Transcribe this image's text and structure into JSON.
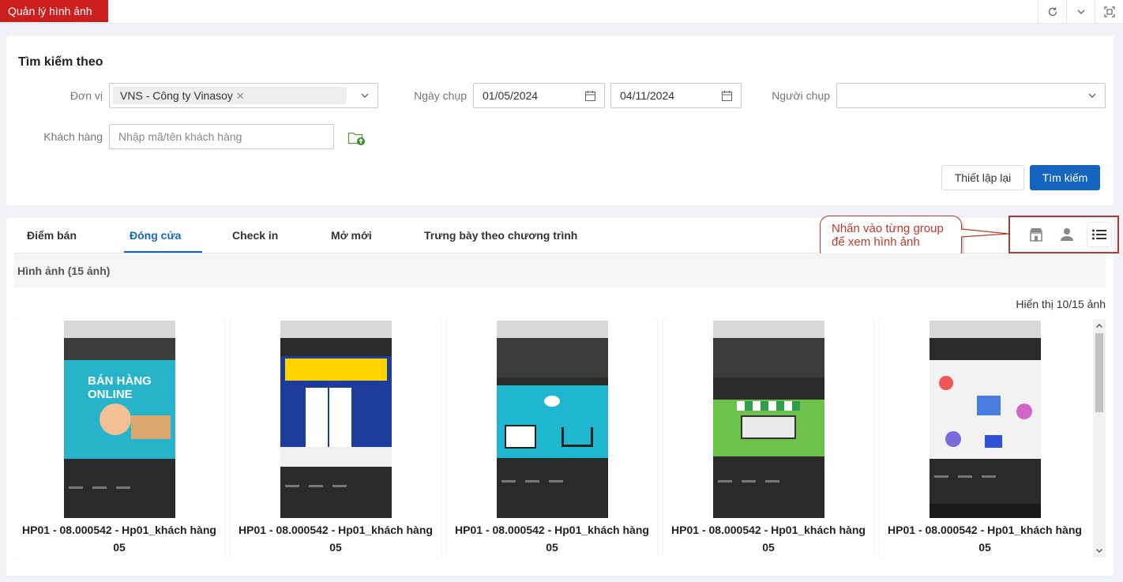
{
  "app": {
    "title": "Quản lý hình ảnh"
  },
  "top_icons": [
    "refresh-icon",
    "chevron-down-icon",
    "fullscreen-icon"
  ],
  "search": {
    "title": "Tìm kiếm theo",
    "unit_label": "Đơn vị",
    "unit_tag": "VNS - Công ty Vinasoy",
    "date_label": "Ngày chụp",
    "date_from": "01/05/2024",
    "date_to": "04/11/2024",
    "photographer_label": "Người chụp",
    "photographer_value": "",
    "customer_label": "Khách hàng",
    "customer_placeholder": "Nhập mã/tên khách hàng",
    "reset_label": "Thiết lập lại",
    "search_label": "Tìm kiếm"
  },
  "tabs": [
    {
      "label": "Điểm bán"
    },
    {
      "label": "Đóng cửa"
    },
    {
      "label": "Check in"
    },
    {
      "label": "Mở mới"
    },
    {
      "label": "Trưng bày theo chương trình"
    }
  ],
  "active_tab": "Đóng cửa",
  "callout": {
    "line1": "Nhấn vào từng group",
    "line2": "để xem hình ảnh"
  },
  "view_modes": [
    "store-icon",
    "person-icon",
    "list-icon"
  ],
  "section": {
    "title": "Hình ảnh (15 ảnh)",
    "count_text": "Hiển thị 10/15 ảnh"
  },
  "images": [
    {
      "caption_line1": "HP01 - 08.000542 - Hp01_khách hàng",
      "caption_line2": "05",
      "overlay_text": "BÁN HÀNG ONLINE"
    },
    {
      "caption_line1": "HP01 - 08.000542 - Hp01_khách hàng",
      "caption_line2": "05"
    },
    {
      "caption_line1": "HP01 - 08.000542 - Hp01_khách hàng",
      "caption_line2": "05"
    },
    {
      "caption_line1": "HP01 - 08.000542 - Hp01_khách hàng",
      "caption_line2": "05"
    },
    {
      "caption_line1": "HP01 - 08.000542 - Hp01_khách hàng",
      "caption_line2": "05"
    }
  ],
  "colors": {
    "brand_red": "#cc1f1f",
    "primary_blue": "#1565c0",
    "callout_red": "#c0392b"
  }
}
